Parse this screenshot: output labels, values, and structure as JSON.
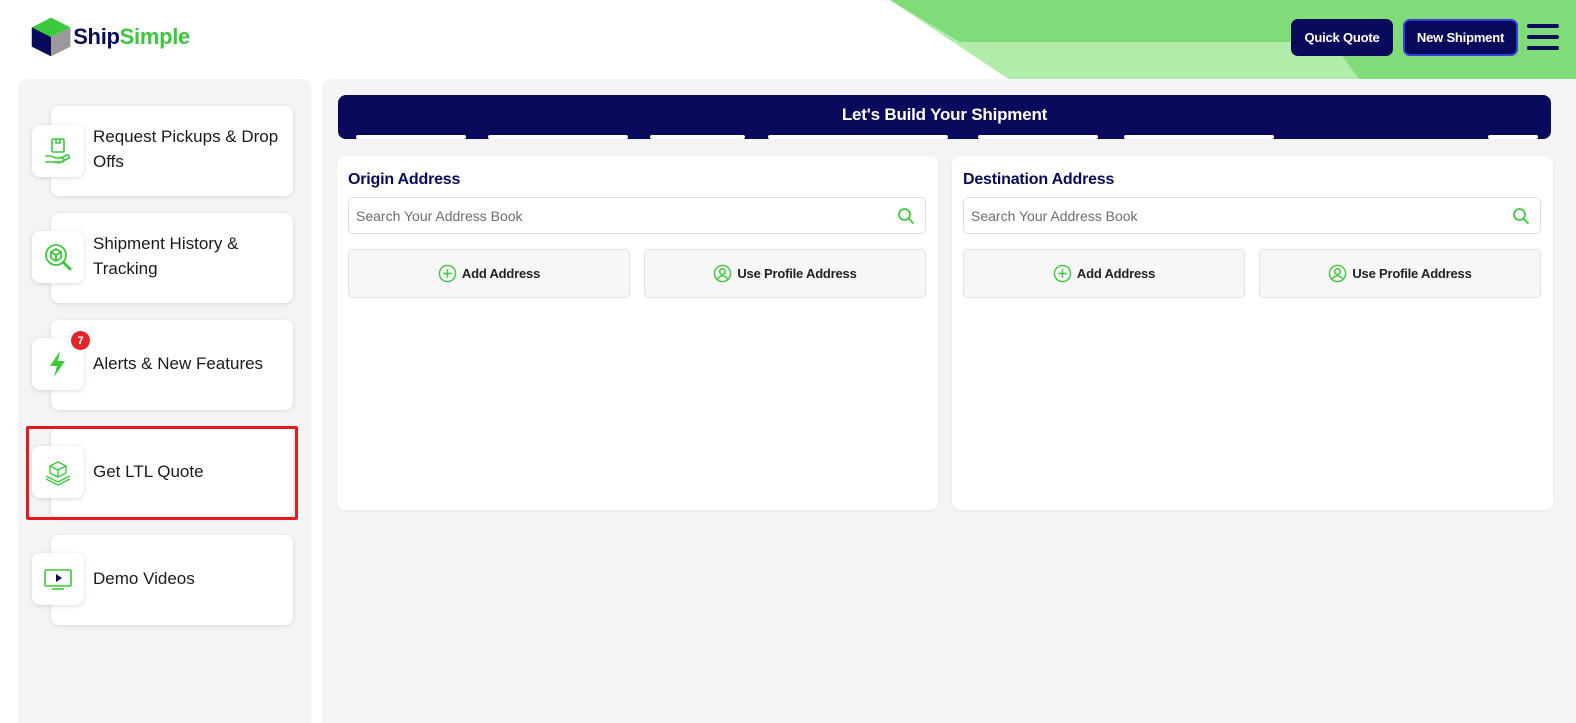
{
  "brand": {
    "name_part1": "Ship",
    "name_part2": "Simple",
    "navy": "#0a0a5c",
    "green": "#3cc83c"
  },
  "header": {
    "quick_quote_label": "Quick Quote",
    "new_shipment_label": "New Shipment"
  },
  "sidebar": {
    "items": [
      {
        "label": "Request Pickups & Drop Offs",
        "icon": "pickup-package-icon"
      },
      {
        "label": "Shipment History & Tracking",
        "icon": "tracking-search-icon"
      },
      {
        "label": "Alerts & New Features",
        "icon": "lightning-icon",
        "badge": "7"
      },
      {
        "label": "Get LTL Quote",
        "icon": "pallet-icon",
        "highlighted": true
      },
      {
        "label": "Demo Videos",
        "icon": "video-play-icon"
      }
    ]
  },
  "main": {
    "banner_title": "Let's Build Your Shipment",
    "origin": {
      "title": "Origin Address",
      "search_placeholder": "Search Your Address Book",
      "add_label": "Add Address",
      "profile_label": "Use Profile Address"
    },
    "destination": {
      "title": "Destination Address",
      "search_placeholder": "Search Your Address Book",
      "add_label": "Add Address",
      "profile_label": "Use Profile Address"
    }
  }
}
